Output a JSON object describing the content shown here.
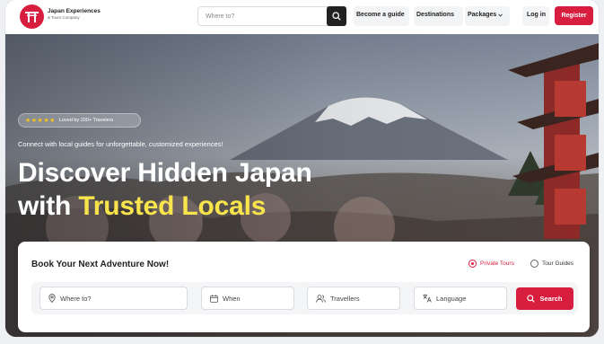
{
  "brand": {
    "name": "Japan Experiences",
    "sub": "& Tours Company"
  },
  "nav": {
    "search_placeholder": "Where to?",
    "links": [
      "Become a guide",
      "Destinations",
      "Packages"
    ],
    "login": "Log in",
    "register": "Register"
  },
  "hero": {
    "badge_stars": "★★★★★",
    "badge_text": "Loved by 200+ Travelers",
    "tagline": "Connect with local guides for unforgettable, customized experiences!",
    "headline_1": "Discover Hidden Japan",
    "headline_2a": "with ",
    "headline_2b": "Trusted Locals"
  },
  "booking": {
    "title": "Book Your Next Adventure Now!",
    "options": [
      {
        "label": "Private Tours",
        "selected": true
      },
      {
        "label": "Tour Guides",
        "selected": false
      }
    ],
    "fields": [
      {
        "placeholder": "Where to?",
        "icon": "location-pin-icon"
      },
      {
        "placeholder": "When",
        "icon": "calendar-icon"
      },
      {
        "placeholder": "Travellers",
        "icon": "users-icon"
      },
      {
        "placeholder": "Language",
        "icon": "translate-icon"
      }
    ],
    "search_label": "Search"
  },
  "colors": {
    "accent": "#d81e3f",
    "highlight": "#f9e44b"
  }
}
